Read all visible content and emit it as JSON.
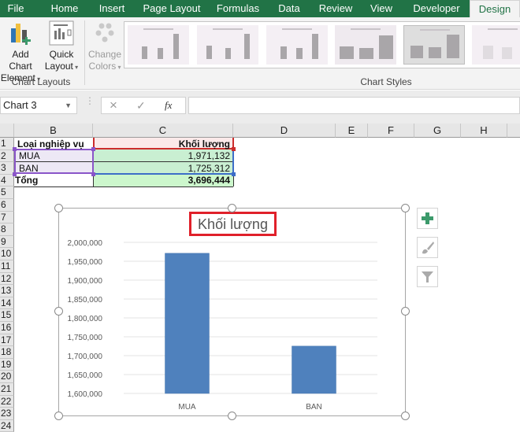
{
  "ribbon": {
    "tabs": [
      "File",
      "Home",
      "Insert",
      "Page Layout",
      "Formulas",
      "Data",
      "Review",
      "View",
      "Developer",
      "Design"
    ],
    "active_tab": "Design",
    "add_chart_element": [
      "Add Chart",
      "Element"
    ],
    "quick_layout": [
      "Quick",
      "Layout"
    ],
    "change_colors": [
      "Change",
      "Colors"
    ],
    "group_chart_layouts": "Chart Layouts",
    "group_chart_styles": "Chart Styles"
  },
  "formula_bar": {
    "name_box": "Chart 3",
    "cancel_icon": "×",
    "enter_icon": "✓",
    "fx_label": "fx",
    "value": ""
  },
  "grid": {
    "columns": [
      "B",
      "C",
      "D",
      "E",
      "F",
      "G",
      "H"
    ],
    "rows": [
      "1",
      "2",
      "3",
      "4",
      "5",
      "6",
      "7",
      "8",
      "9",
      "10",
      "11",
      "12",
      "13",
      "14",
      "15",
      "16",
      "17",
      "18",
      "19",
      "20",
      "21",
      "22",
      "23",
      "24"
    ],
    "cells": {
      "B1": "Loại nghiệp vụ",
      "C1": "Khối lượng",
      "B2": "MUA",
      "C2": "1,971,132",
      "B3": "BAN",
      "C3": "1,725,312",
      "B4": "Tổng",
      "C4": "3,696,444"
    }
  },
  "chart_data": {
    "type": "bar",
    "title": "Khối lượng",
    "categories": [
      "MUA",
      "BAN"
    ],
    "values": [
      1971132,
      1725312
    ],
    "ylim": [
      1600000,
      2000000
    ],
    "yticks": [
      "2,000,000",
      "1,950,000",
      "1,900,000",
      "1,850,000",
      "1,800,000",
      "1,750,000",
      "1,700,000",
      "1,650,000",
      "1,600,000"
    ],
    "xlabel": "",
    "ylabel": "",
    "grid": true,
    "bar_color": "#4f81bd"
  },
  "chart_side_buttons": {
    "elements": "+",
    "styles": "brush",
    "filters": "filter"
  },
  "colors": {
    "excel_green": "#217346",
    "title_box": "#e0202a"
  }
}
